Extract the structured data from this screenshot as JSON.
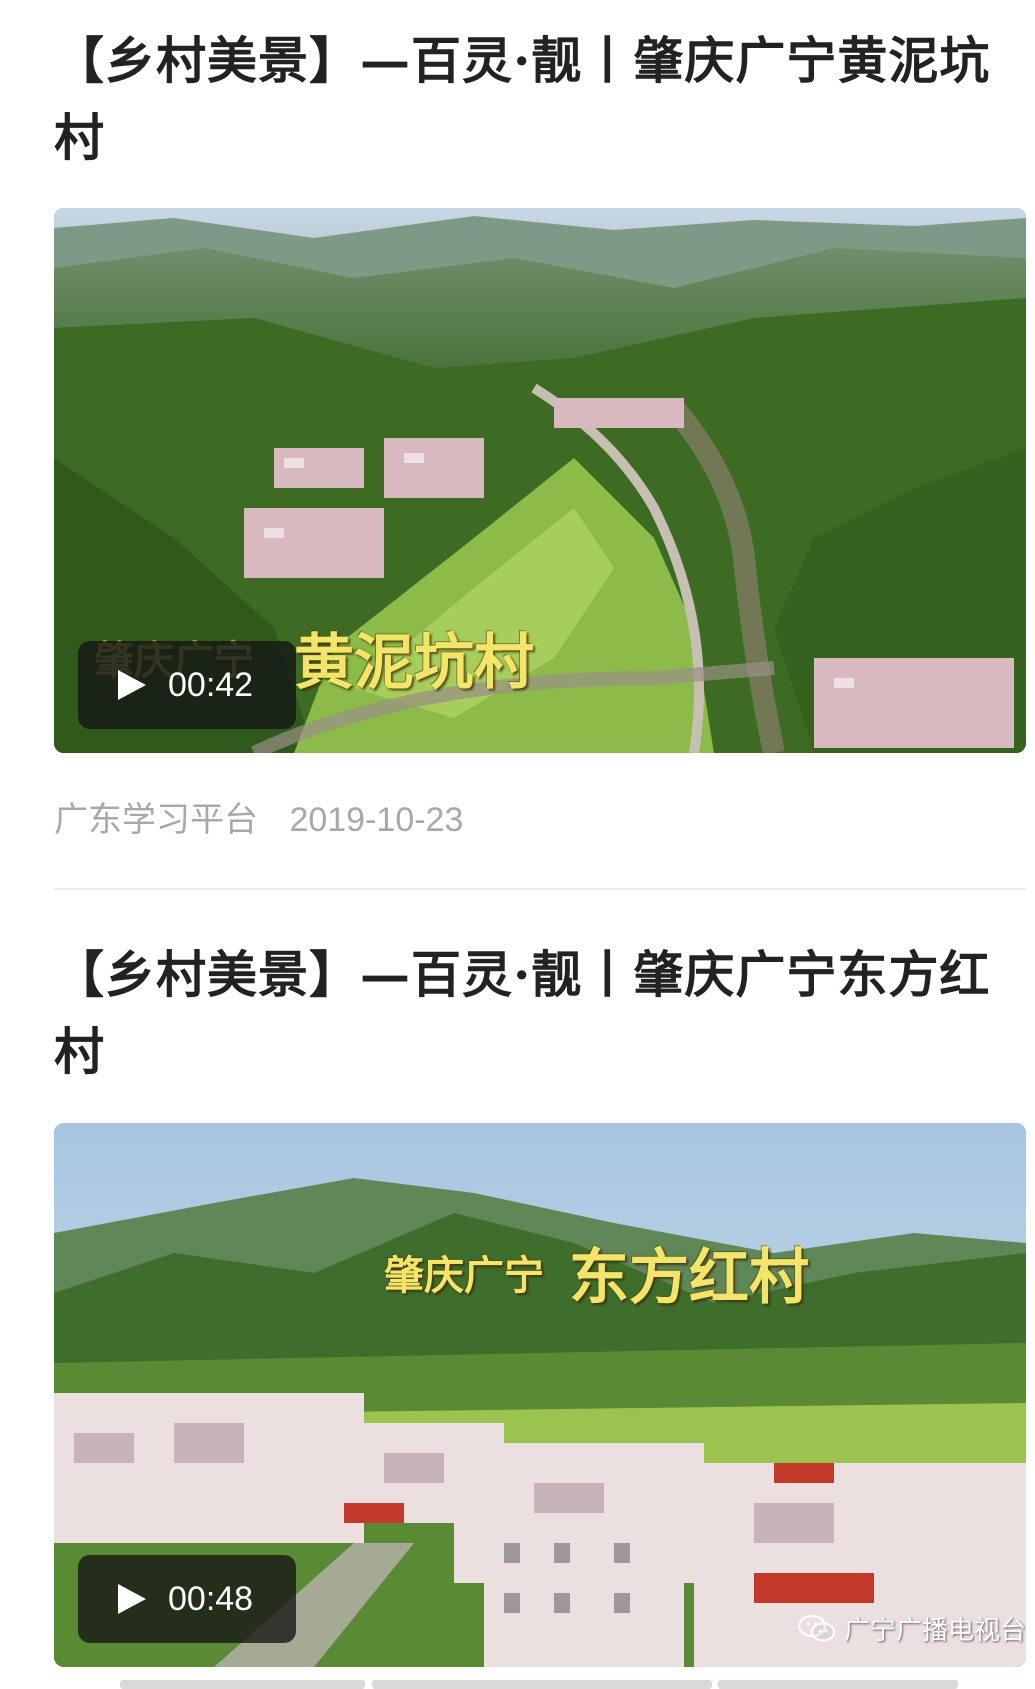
{
  "articles": [
    {
      "title": "【乡村美景】—百灵·靓丨肇庆广宁黄泥坑村",
      "video": {
        "duration": "00:42",
        "overlay_small": "肇庆广宁",
        "overlay_large": "黄泥坑村"
      },
      "source": "广东学习平台",
      "date": "2019-10-23"
    },
    {
      "title": "【乡村美景】—百灵·靓丨肇庆广宁东方红村",
      "video": {
        "duration": "00:48",
        "overlay_small": "肇庆广宁",
        "overlay_large": "东方红村"
      },
      "watermark": "广宁广播电视台"
    }
  ],
  "colors": {
    "title": "#222222",
    "meta": "#a8a8a8",
    "overlay": "#f2e56a",
    "badge": "#141414"
  }
}
